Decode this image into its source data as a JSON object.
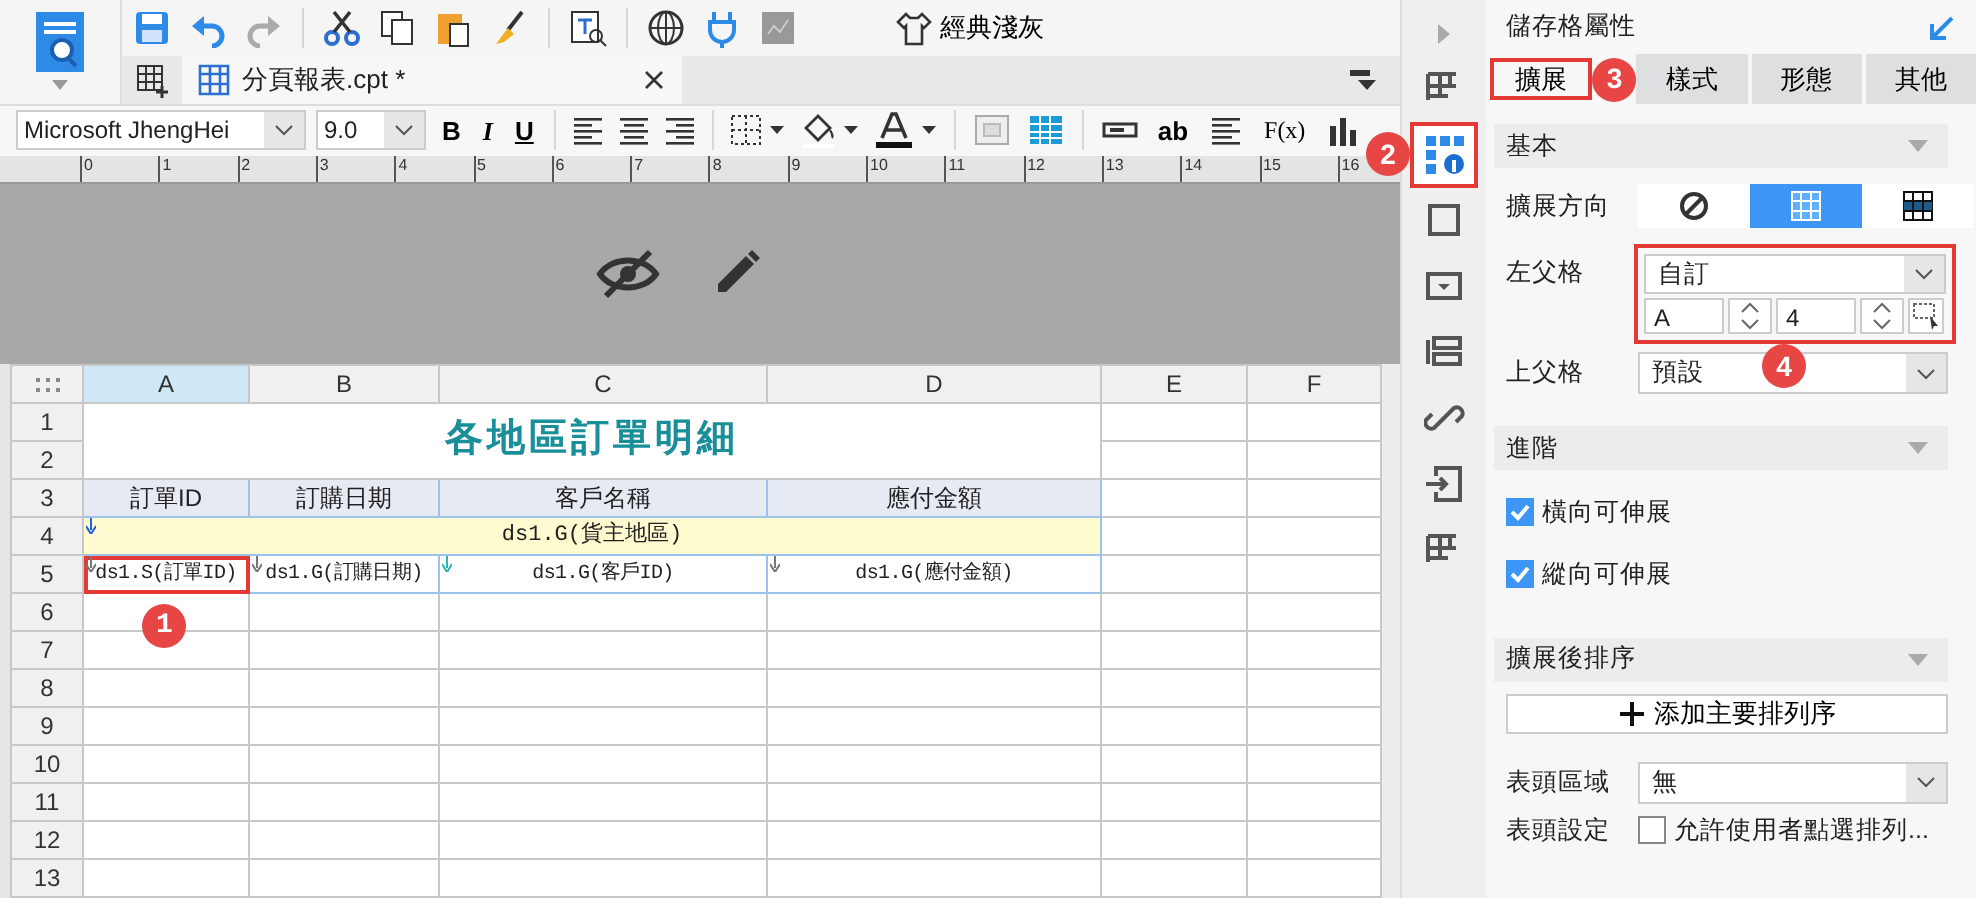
{
  "toolbar": {
    "theme_button": "經典淺灰"
  },
  "file_tabs": [
    {
      "label": "分頁報表.cpt *",
      "selected": true
    }
  ],
  "format_bar": {
    "font": "Microsoft JhengHei",
    "size": "9.0",
    "bold": "B",
    "italic": "I",
    "underline": "U",
    "text_label": "ab",
    "formula": "F(x)"
  },
  "ruler_ticks": [
    "0",
    "1",
    "2",
    "3",
    "4",
    "5",
    "6",
    "7",
    "8",
    "9",
    "10",
    "11",
    "12",
    "13",
    "14",
    "15",
    "16"
  ],
  "sheet": {
    "columns": [
      {
        "label": "A",
        "selected": true
      },
      {
        "label": "B",
        "selected": false
      },
      {
        "label": "C",
        "selected": false
      },
      {
        "label": "D",
        "selected": false
      },
      {
        "label": "E",
        "selected": false
      },
      {
        "label": "F",
        "selected": false
      }
    ],
    "rows": [
      "1",
      "2",
      "3",
      "4",
      "5",
      "6",
      "7",
      "8",
      "9",
      "10",
      "11",
      "12",
      "13"
    ],
    "title": "各地區訂單明細",
    "headers": [
      "訂單ID",
      "訂購日期",
      "客戶名稱",
      "應付金額"
    ],
    "group_cell": "ds1.G(貨主地區)",
    "data_cells": [
      {
        "text": "ds1.S(訂單ID)",
        "selected": true,
        "callout": "1"
      },
      {
        "text": "ds1.G(訂購日期)",
        "selected": false
      },
      {
        "text": "ds1.G(客戶ID)",
        "selected": false
      },
      {
        "text": "ds1.G(應付金額)",
        "selected": false
      }
    ]
  },
  "side_strip": [
    {
      "selected": false
    },
    {
      "selected": true,
      "callout": "2"
    },
    {
      "selected": false
    },
    {
      "selected": false
    },
    {
      "selected": false
    },
    {
      "selected": false
    },
    {
      "selected": false
    },
    {
      "selected": false
    }
  ],
  "panel": {
    "title": "儲存格屬性",
    "tabs": [
      {
        "label": "擴展",
        "selected": true,
        "callout": "3"
      },
      {
        "label": "樣式",
        "selected": false
      },
      {
        "label": "形態",
        "selected": false
      },
      {
        "label": "其他",
        "selected": false
      }
    ],
    "basic": {
      "title": "基本",
      "direction_label": "擴展方向",
      "directions": [
        {
          "kind": "none",
          "selected": false
        },
        {
          "kind": "vertical",
          "selected": true
        },
        {
          "kind": "horizontal",
          "selected": false
        }
      ],
      "left_parent": {
        "label": "左父格",
        "value": "自訂",
        "column": "A",
        "row": "4",
        "callout": "4"
      },
      "top_parent": {
        "label": "上父格",
        "value": "預設"
      }
    },
    "advanced": {
      "title": "進階",
      "options": [
        {
          "label": "橫向可伸展",
          "checked": true
        },
        {
          "label": "縱向可伸展",
          "checked": true
        }
      ]
    },
    "sorting": {
      "title": "擴展後排序",
      "add_button": "添加主要排列序",
      "header_area_label": "表頭區域",
      "header_area_value": "無",
      "header_setting_label": "表頭設定",
      "header_setting_option": {
        "label": "允許使用者點選排列...",
        "checked": false
      }
    }
  }
}
